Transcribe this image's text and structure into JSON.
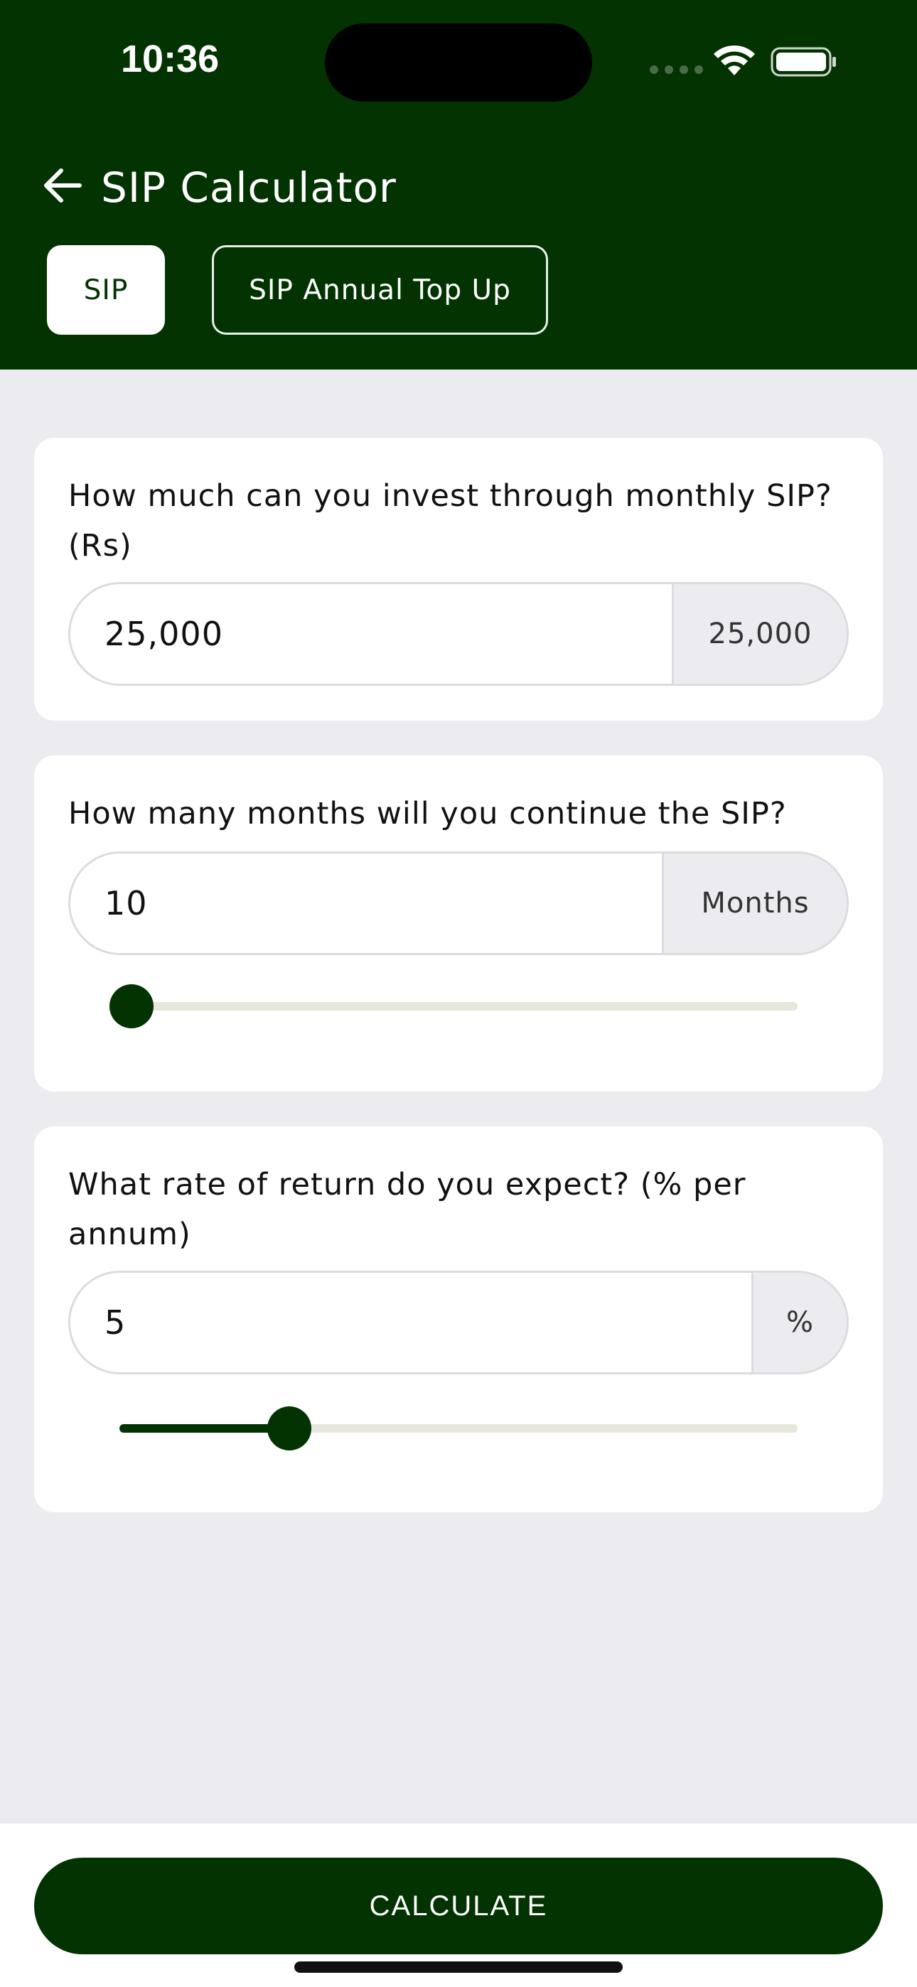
{
  "status_bar": {
    "time": "10:36"
  },
  "header": {
    "title": "SIP Calculator",
    "tabs": [
      {
        "label": "SIP",
        "active": true
      },
      {
        "label": "SIP Annual Top Up",
        "active": false
      }
    ]
  },
  "investment": {
    "question": "How much can you invest through monthly SIP? (Rs)",
    "value": "25,000",
    "suffix": "25,000"
  },
  "duration": {
    "question": "How many months will you continue the SIP?",
    "value": "10",
    "suffix": "Months",
    "slider_level": 0.01
  },
  "rate": {
    "question": "What rate of return do you expect? (% per annum)",
    "value": "5",
    "suffix": "%",
    "slider_level": 0.25
  },
  "calculate_label": "CALCULATE",
  "colors": {
    "brand": "#023300",
    "background": "#ebebf0"
  }
}
